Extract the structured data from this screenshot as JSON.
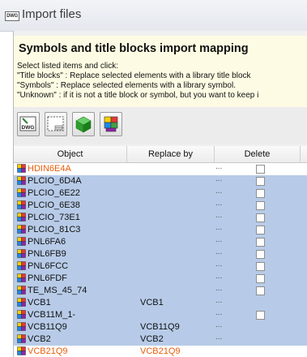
{
  "window": {
    "title": "Import files",
    "title_icon_text": "DWG"
  },
  "header": {
    "heading": "Symbols and title blocks import mapping",
    "instructions": [
      "Select listed items and click:",
      "\"Title blocks\" : Replace selected elements with a library title block",
      "\"Symbols\" : Replace selected elements with a library symbol.",
      "\"Unknown\" : if it is not a title block or symbol, but you want to keep i"
    ]
  },
  "toolbar": {
    "buttons": [
      {
        "name": "dwg-button",
        "icon": "dwg-file-icon",
        "label": "DWG"
      },
      {
        "name": "title-block-button",
        "icon": "title-block-icon"
      },
      {
        "name": "symbol-button",
        "icon": "green-cube-icon"
      },
      {
        "name": "unknown-button",
        "icon": "colored-blocks-icon"
      }
    ]
  },
  "grid": {
    "columns": [
      "Object",
      "Replace by",
      "Delete"
    ],
    "rows": [
      {
        "object": "HDIN6E4A",
        "replace_by": "",
        "dots": "...",
        "checkbox": true,
        "selected": false,
        "orange": true
      },
      {
        "object": "PLCIO_6D4A",
        "replace_by": "",
        "dots": "...",
        "checkbox": true,
        "selected": true,
        "orange": false
      },
      {
        "object": "PLCIO_6E22",
        "replace_by": "",
        "dots": "...",
        "checkbox": true,
        "selected": true,
        "orange": false
      },
      {
        "object": "PLCIO_6E38",
        "replace_by": "",
        "dots": "...",
        "checkbox": true,
        "selected": true,
        "orange": false
      },
      {
        "object": "PLCIO_73E1",
        "replace_by": "",
        "dots": "...",
        "checkbox": true,
        "selected": true,
        "orange": false
      },
      {
        "object": "PLCIO_81C3",
        "replace_by": "",
        "dots": "...",
        "checkbox": true,
        "selected": true,
        "orange": false
      },
      {
        "object": "PNL6FA6",
        "replace_by": "",
        "dots": "...",
        "checkbox": true,
        "selected": true,
        "orange": false
      },
      {
        "object": "PNL6FB9",
        "replace_by": "",
        "dots": "...",
        "checkbox": true,
        "selected": true,
        "orange": false
      },
      {
        "object": "PNL6FCC",
        "replace_by": "",
        "dots": "...",
        "checkbox": true,
        "selected": true,
        "orange": false
      },
      {
        "object": "PNL6FDF",
        "replace_by": "",
        "dots": "...",
        "checkbox": true,
        "selected": true,
        "orange": false
      },
      {
        "object": "TE_MS_45_74",
        "replace_by": "",
        "dots": "...",
        "checkbox": true,
        "selected": true,
        "orange": false
      },
      {
        "object": "VCB1",
        "replace_by": "VCB1",
        "dots": "...",
        "checkbox": false,
        "selected": true,
        "orange": false
      },
      {
        "object": "VCB11M_1-",
        "replace_by": "",
        "dots": "...",
        "checkbox": true,
        "selected": true,
        "orange": false
      },
      {
        "object": "VCB11Q9",
        "replace_by": "VCB11Q9",
        "dots": "...",
        "checkbox": false,
        "selected": true,
        "orange": false
      },
      {
        "object": "VCB2",
        "replace_by": "VCB2",
        "dots": "...",
        "checkbox": false,
        "selected": true,
        "orange": false
      },
      {
        "object": "VCB21Q9",
        "replace_by": "VCB21Q9",
        "dots": "",
        "checkbox": false,
        "selected": false,
        "orange": true
      }
    ]
  },
  "colors": {
    "selection": "#b7cbe8",
    "header_bg": "#fdfbe3",
    "orange_text": "#e85d0a"
  }
}
